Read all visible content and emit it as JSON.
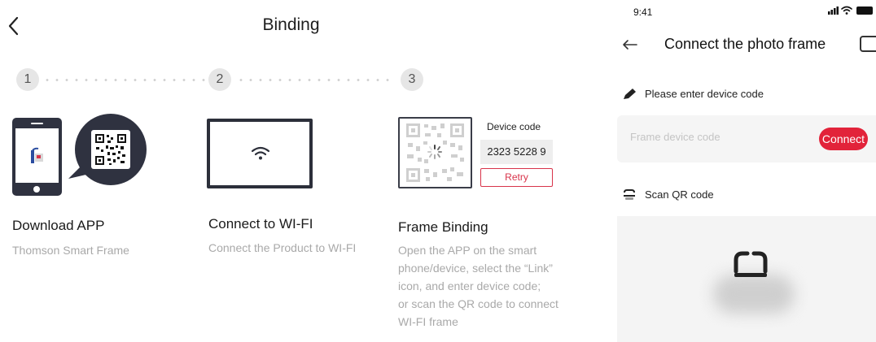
{
  "left": {
    "title": "Binding",
    "steps": [
      "1",
      "2",
      "3"
    ],
    "columns": [
      {
        "title": "Download APP",
        "subtitle": "Thomson Smart Frame"
      },
      {
        "title": "Connect to WI-FI",
        "subtitle": "Connect the Product to WI-FI"
      },
      {
        "title": "Frame Binding",
        "subtitle_lines": [
          "Open the APP on the smart",
          "phone/device, select the “Link”",
          "icon, and enter device code;",
          "or scan the QR code to connect",
          "WI-FI frame"
        ]
      }
    ],
    "device_code_label": "Device code",
    "device_code": "2323 5228 9",
    "retry_label": "Retry"
  },
  "right": {
    "time": "9:41",
    "title": "Connect the photo frame",
    "enter_code_label": "Please enter device code",
    "code_placeholder": "Frame device code",
    "connect_label": "Connect",
    "scan_label": "Scan QR code"
  },
  "colors": {
    "accent": "#e2233a",
    "retry": "#d8334a",
    "dark": "#2c2f3a"
  },
  "icons": [
    "back-chevron-icon",
    "phone-icon",
    "qr-bubble-icon",
    "wifi-icon",
    "qr-code-icon",
    "loading-spinner-icon",
    "signal-icon",
    "wifi-status-icon",
    "battery-icon",
    "back-arrow-icon",
    "pencil-icon",
    "scan-icon"
  ]
}
